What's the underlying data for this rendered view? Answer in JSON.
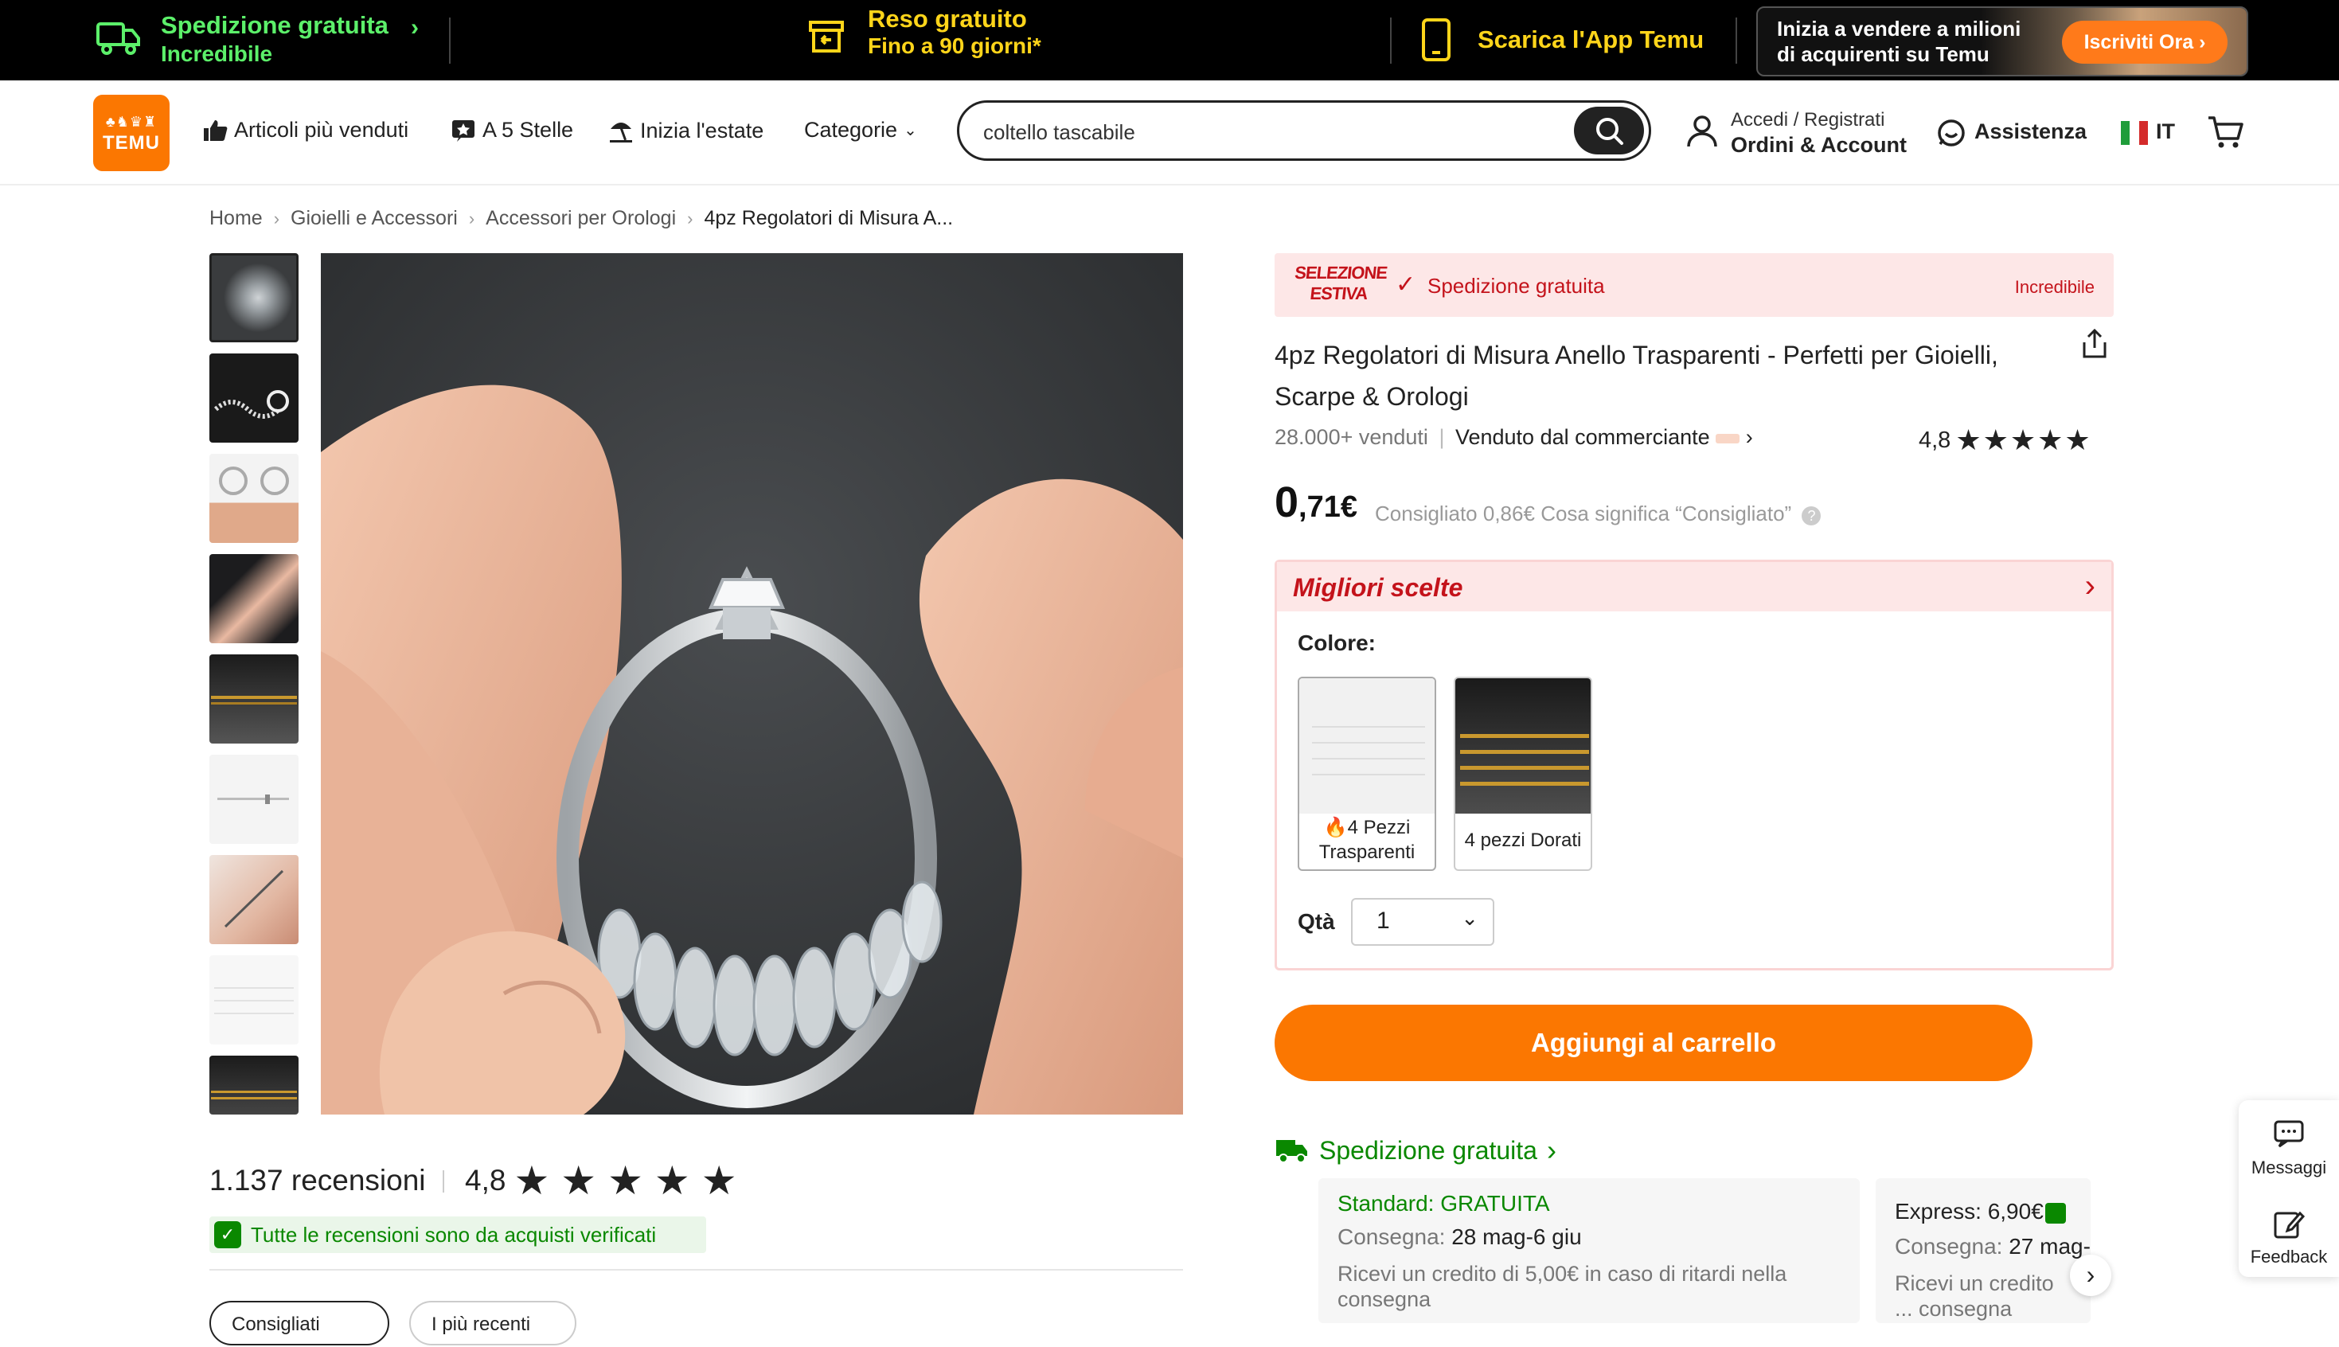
{
  "top_banner": {
    "shipping_title": "Spedizione gratuita",
    "shipping_sub": "Incredibile",
    "returns_title": "Reso gratuito",
    "returns_sub": "Fino a 90 giorni*",
    "app_label": "Scarica l'App Temu",
    "promo_text_line1": "Inizia a vendere a milioni",
    "promo_text_line2": "di acquirenti su Temu",
    "promo_button": "Iscriviti Ora"
  },
  "header": {
    "logo_line1": "Temu",
    "logo_line2": "TEMU",
    "nav": {
      "bestsellers": "Articoli più venduti",
      "five_stars": "A 5 Stelle",
      "summer": "Inizia l'estate",
      "categories": "Categorie"
    },
    "search": {
      "value": "coltello tascabile"
    },
    "account_line1": "Accedi / Registrati",
    "account_line2": "Ordini & Account",
    "support": "Assistenza",
    "language": "IT"
  },
  "breadcrumb": {
    "home": "Home",
    "level1": "Gioielli e Accessori",
    "level2": "Accessori per Orologi",
    "current": "4pz Regolatori di Misura A..."
  },
  "product": {
    "selection_badge_line1": "SELEZIONE",
    "selection_badge_line2": "ESTIVA",
    "free_shipping": "Spedizione gratuita",
    "incredible": "Incredibile",
    "title": "4pz Regolatori di Misura Anello Trasparenti - Perfetti per Gioielli, Scarpe & Orologi",
    "sold": "28.000+ venduti",
    "sold_sep": "|",
    "seller_label": "Venduto dal commerciante",
    "rating": "4,8",
    "stars": 4.8,
    "price_int": "0",
    "price_dec": ",71€",
    "ref_label": "Consigliato",
    "ref_price": "0,86€",
    "ref_question": "Cosa significa “Consigliato”",
    "best_picks": "Migliori scelte",
    "color_label": "Colore:",
    "options": [
      {
        "label": "4 Pezzi Trasparenti"
      },
      {
        "label": "4 pezzi Dorati"
      }
    ],
    "qty_label": "Qtà",
    "qty_value": "1",
    "add_to_cart": "Aggiungi al carrello"
  },
  "shipping": {
    "title": "Spedizione gratuita",
    "standard_title": "Standard: GRATUITA",
    "standard_delivery_label": "Consegna:",
    "standard_delivery_value": "28 mag-6 giu",
    "standard_note": "Ricevi un credito di 5,00€ in caso di ritardi nella consegna",
    "express_title": "Express: 6,90€",
    "express_delivery_label": "Consegna:",
    "express_delivery_value": "27 mag-",
    "express_note": "Ricevi un credito ... consegna"
  },
  "reviews": {
    "count": "1.137 recensioni",
    "rating": "4,8",
    "stars": 4.8,
    "verified": "Tutte le recensioni sono da acquisti verificati",
    "tab1": "Consigliati",
    "tab2": "I più recenti"
  },
  "side_panel": {
    "messages": "Messaggi",
    "feedback": "Feedback"
  },
  "colors": {
    "brand_orange": "#fb7701",
    "green": "#0a8800",
    "red": "#c4131b",
    "banner_green": "#5cf06a",
    "banner_yellow": "#ffd51a"
  }
}
